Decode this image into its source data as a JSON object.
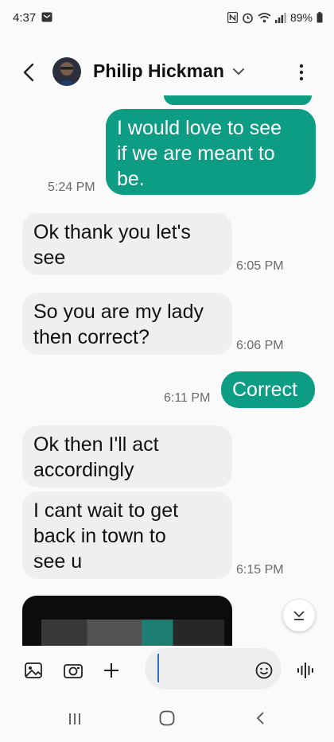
{
  "status_bar": {
    "time": "4:37",
    "battery": "89%"
  },
  "header": {
    "contact_name": "Philip Hickman"
  },
  "messages": [
    {
      "type": "sent",
      "text_lines": [
        "I would love to see",
        "if we are meant to",
        "be."
      ],
      "time": "5:24 PM"
    },
    {
      "type": "received",
      "text_lines": [
        "Ok thank you let's",
        "see"
      ],
      "time": "6:05 PM"
    },
    {
      "type": "received",
      "text_lines": [
        "So you are my lady",
        "then correct?"
      ],
      "time": "6:06 PM"
    },
    {
      "type": "sent",
      "text_lines": [
        "Correct"
      ],
      "time": "6:11 PM"
    },
    {
      "type": "received",
      "text_lines": [
        "Ok then I'll act",
        "accordingly"
      ],
      "time": ""
    },
    {
      "type": "received",
      "text_lines": [
        "I cant wait to get",
        "back in town to",
        "see u"
      ],
      "time": "6:15 PM"
    }
  ],
  "compose": {
    "input_value": "",
    "icons": [
      "gallery-icon",
      "camera-icon",
      "plus-icon",
      "emoji-icon",
      "voice-icon"
    ]
  },
  "colors": {
    "sent_bubble": "#0d9d84",
    "received_bubble": "#efefef"
  }
}
